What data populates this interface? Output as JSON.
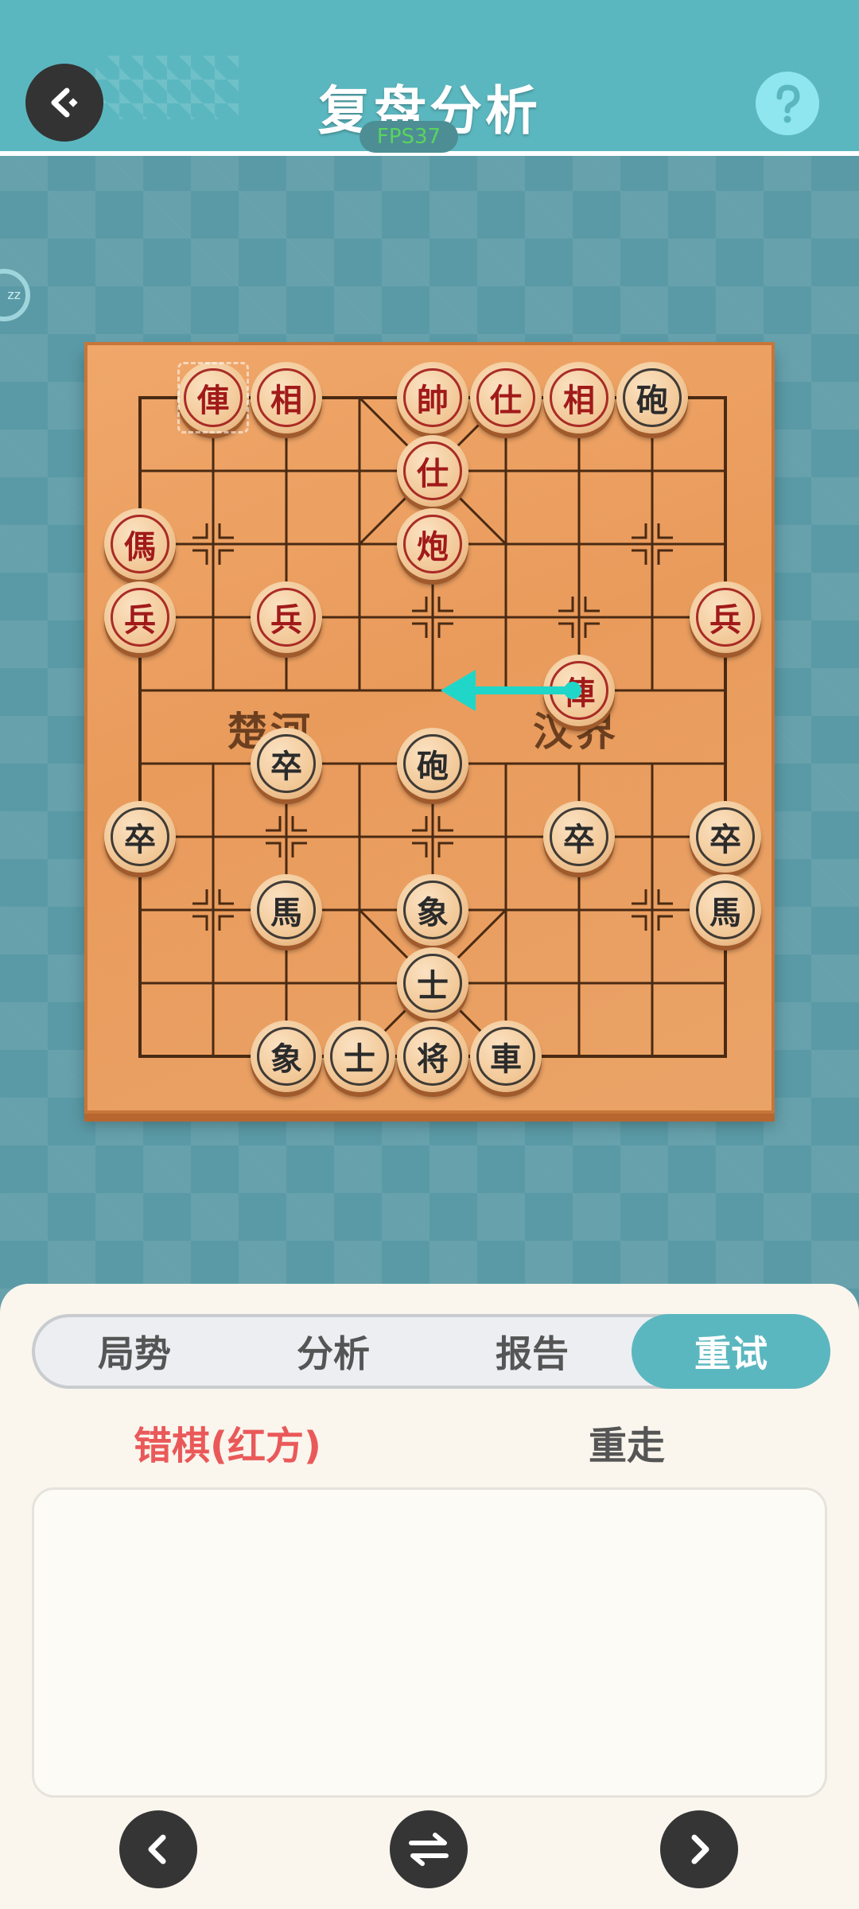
{
  "header": {
    "title": "复盘分析",
    "fps": "FPS37",
    "back_icon": "back-arrow-icon",
    "help_icon": "help-question-icon"
  },
  "side_badge": {
    "text": "zz"
  },
  "board": {
    "river_left": "楚河",
    "river_right": "汉界",
    "pieces": [
      {
        "name": "red-chariot",
        "label": "俥",
        "side": "red",
        "col": 1,
        "row": 0
      },
      {
        "name": "red-elephant",
        "label": "相",
        "side": "red",
        "col": 2,
        "row": 0
      },
      {
        "name": "red-general",
        "label": "帥",
        "side": "red",
        "col": 4,
        "row": 0
      },
      {
        "name": "red-advisor",
        "label": "仕",
        "side": "red",
        "col": 5,
        "row": 0
      },
      {
        "name": "red-elephant",
        "label": "相",
        "side": "red",
        "col": 6,
        "row": 0
      },
      {
        "name": "black-cannon",
        "label": "砲",
        "side": "black",
        "col": 7,
        "row": 0
      },
      {
        "name": "red-advisor",
        "label": "仕",
        "side": "red",
        "col": 4,
        "row": 1
      },
      {
        "name": "red-horse",
        "label": "傌",
        "side": "red",
        "col": 0,
        "row": 2
      },
      {
        "name": "red-cannon",
        "label": "炮",
        "side": "red",
        "col": 4,
        "row": 2
      },
      {
        "name": "red-soldier",
        "label": "兵",
        "side": "red",
        "col": 0,
        "row": 3
      },
      {
        "name": "red-soldier",
        "label": "兵",
        "side": "red",
        "col": 2,
        "row": 3
      },
      {
        "name": "red-soldier",
        "label": "兵",
        "side": "red",
        "col": 8,
        "row": 3
      },
      {
        "name": "red-chariot",
        "label": "俥",
        "side": "red",
        "col": 6,
        "row": 4
      },
      {
        "name": "black-soldier",
        "label": "卒",
        "side": "black",
        "col": 2,
        "row": 5
      },
      {
        "name": "black-cannon",
        "label": "砲",
        "side": "black",
        "col": 4,
        "row": 5
      },
      {
        "name": "black-soldier",
        "label": "卒",
        "side": "black",
        "col": 0,
        "row": 6
      },
      {
        "name": "black-soldier",
        "label": "卒",
        "side": "black",
        "col": 6,
        "row": 6
      },
      {
        "name": "black-soldier",
        "label": "卒",
        "side": "black",
        "col": 8,
        "row": 6
      },
      {
        "name": "black-horse",
        "label": "馬",
        "side": "black",
        "col": 2,
        "row": 7
      },
      {
        "name": "black-elephant",
        "label": "象",
        "side": "black",
        "col": 4,
        "row": 7
      },
      {
        "name": "black-horse",
        "label": "馬",
        "side": "black",
        "col": 8,
        "row": 7
      },
      {
        "name": "black-advisor",
        "label": "士",
        "side": "black",
        "col": 4,
        "row": 8
      },
      {
        "name": "black-elephant",
        "label": "象",
        "side": "black",
        "col": 2,
        "row": 9
      },
      {
        "name": "black-advisor",
        "label": "士",
        "side": "black",
        "col": 3,
        "row": 9
      },
      {
        "name": "black-general",
        "label": "将",
        "side": "black",
        "col": 4,
        "row": 9
      },
      {
        "name": "black-chariot",
        "label": "車",
        "side": "black",
        "col": 5,
        "row": 9
      }
    ],
    "last_move_from": {
      "col": 1,
      "row": 0
    },
    "hint_arrow": {
      "from": {
        "col": 6,
        "row": 4
      },
      "to": {
        "col": 4,
        "row": 4
      },
      "color": "#1fd6c9"
    }
  },
  "panel": {
    "tabs": [
      {
        "label": "局势",
        "active": false
      },
      {
        "label": "分析",
        "active": false
      },
      {
        "label": "报告",
        "active": false
      },
      {
        "label": "重试",
        "active": true
      }
    ],
    "mistake_label": "错棋(红方)",
    "redo_label": "重走",
    "nav": {
      "prev_icon": "chevron-left-icon",
      "swap_icon": "swap-arrows-icon",
      "next_icon": "chevron-right-icon"
    }
  }
}
